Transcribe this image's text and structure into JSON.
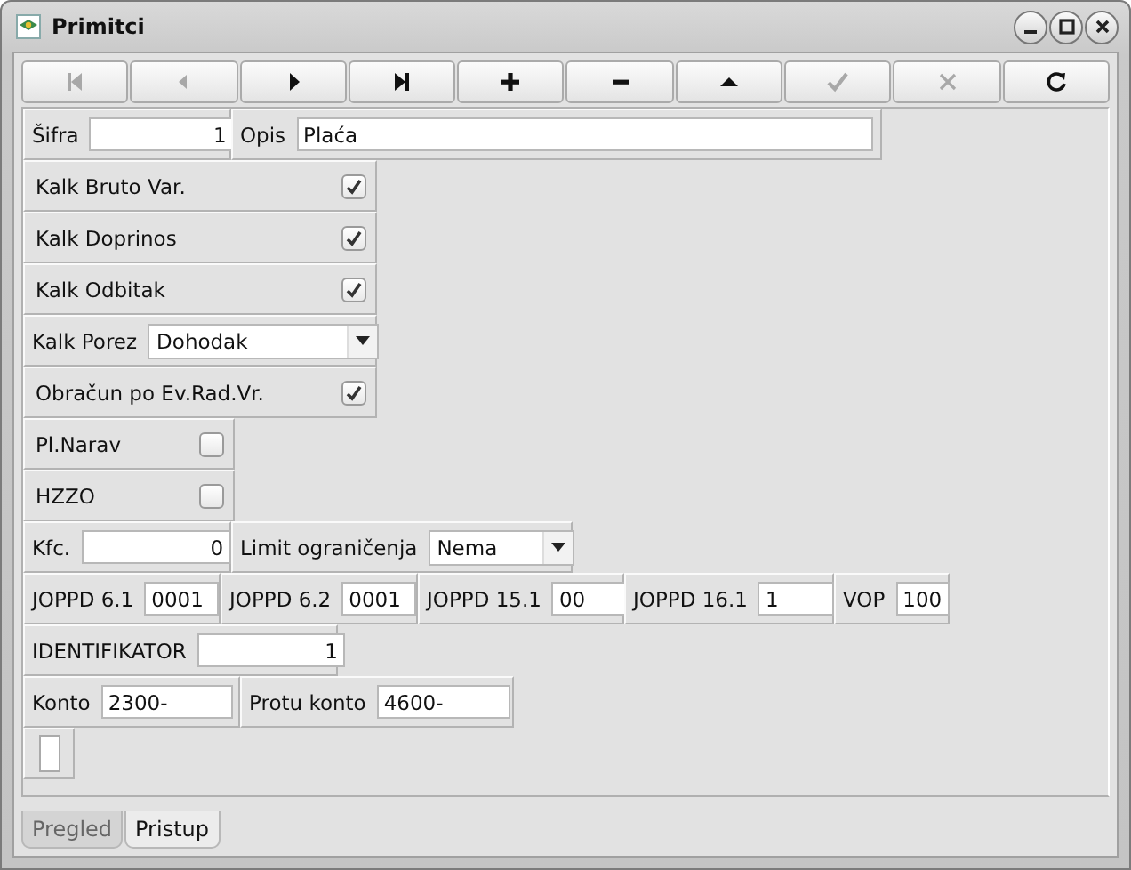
{
  "window": {
    "title": "Primitci"
  },
  "toolbar": [
    {
      "kind": "first",
      "disabled": true
    },
    {
      "kind": "prev",
      "disabled": true
    },
    {
      "kind": "next",
      "disabled": false
    },
    {
      "kind": "last",
      "disabled": false
    },
    {
      "kind": "add",
      "disabled": false
    },
    {
      "kind": "remove",
      "disabled": false
    },
    {
      "kind": "up",
      "disabled": false
    },
    {
      "kind": "save",
      "disabled": true
    },
    {
      "kind": "cancel",
      "disabled": true
    },
    {
      "kind": "refresh",
      "disabled": false
    }
  ],
  "rows": [
    {
      "cells": [
        {
          "kind": "number",
          "label": "Šifra",
          "value": "1"
        },
        {
          "kind": "text",
          "label": "Opis",
          "value": "Plaća"
        }
      ]
    },
    {
      "cells": [
        {
          "kind": "check",
          "label": "Kalk Bruto Var.",
          "checked": true
        }
      ]
    },
    {
      "cells": [
        {
          "kind": "check",
          "label": "Kalk Doprinos",
          "checked": true
        }
      ]
    },
    {
      "cells": [
        {
          "kind": "check",
          "label": "Kalk Odbitak",
          "checked": true
        }
      ]
    },
    {
      "cells": [
        {
          "kind": "combo",
          "label": "Kalk Porez",
          "value": "Dohodak"
        }
      ]
    },
    {
      "cells": [
        {
          "kind": "check",
          "label": "Obračun po Ev.Rad.Vr.",
          "checked": true
        }
      ]
    },
    {
      "cells": [
        {
          "kind": "check",
          "label": "Pl.Narav",
          "checked": false
        }
      ]
    },
    {
      "cells": [
        {
          "kind": "check",
          "label": "HZZO",
          "checked": false
        }
      ]
    },
    {
      "cells": [
        {
          "kind": "number",
          "label": "Kfc.",
          "value": "0"
        },
        {
          "kind": "combo",
          "label": "Limit ograničenja",
          "value": "Nema"
        }
      ]
    },
    {
      "cells": [
        {
          "kind": "text",
          "label": "JOPPD 6.1",
          "value": "0001"
        },
        {
          "kind": "text",
          "label": "JOPPD 6.2",
          "value": "0001"
        },
        {
          "kind": "text",
          "label": "JOPPD 15.1",
          "value": "00"
        },
        {
          "kind": "text",
          "label": "JOPPD 16.1",
          "value": "1"
        },
        {
          "kind": "text",
          "label": "VOP",
          "value": "100"
        }
      ]
    },
    {
      "cells": [
        {
          "kind": "number",
          "label": "IDENTIFIKATOR",
          "value": "1"
        }
      ]
    },
    {
      "cells": [
        {
          "kind": "text",
          "label": "Konto",
          "value": "2300-"
        },
        {
          "kind": "text",
          "label": "Protu konto",
          "value": "4600-"
        }
      ]
    },
    {
      "cells": [
        {
          "kind": "blank"
        }
      ]
    }
  ],
  "tabs": [
    {
      "label": "Pregled",
      "selected": false
    },
    {
      "label": "Pristup",
      "selected": true
    }
  ]
}
